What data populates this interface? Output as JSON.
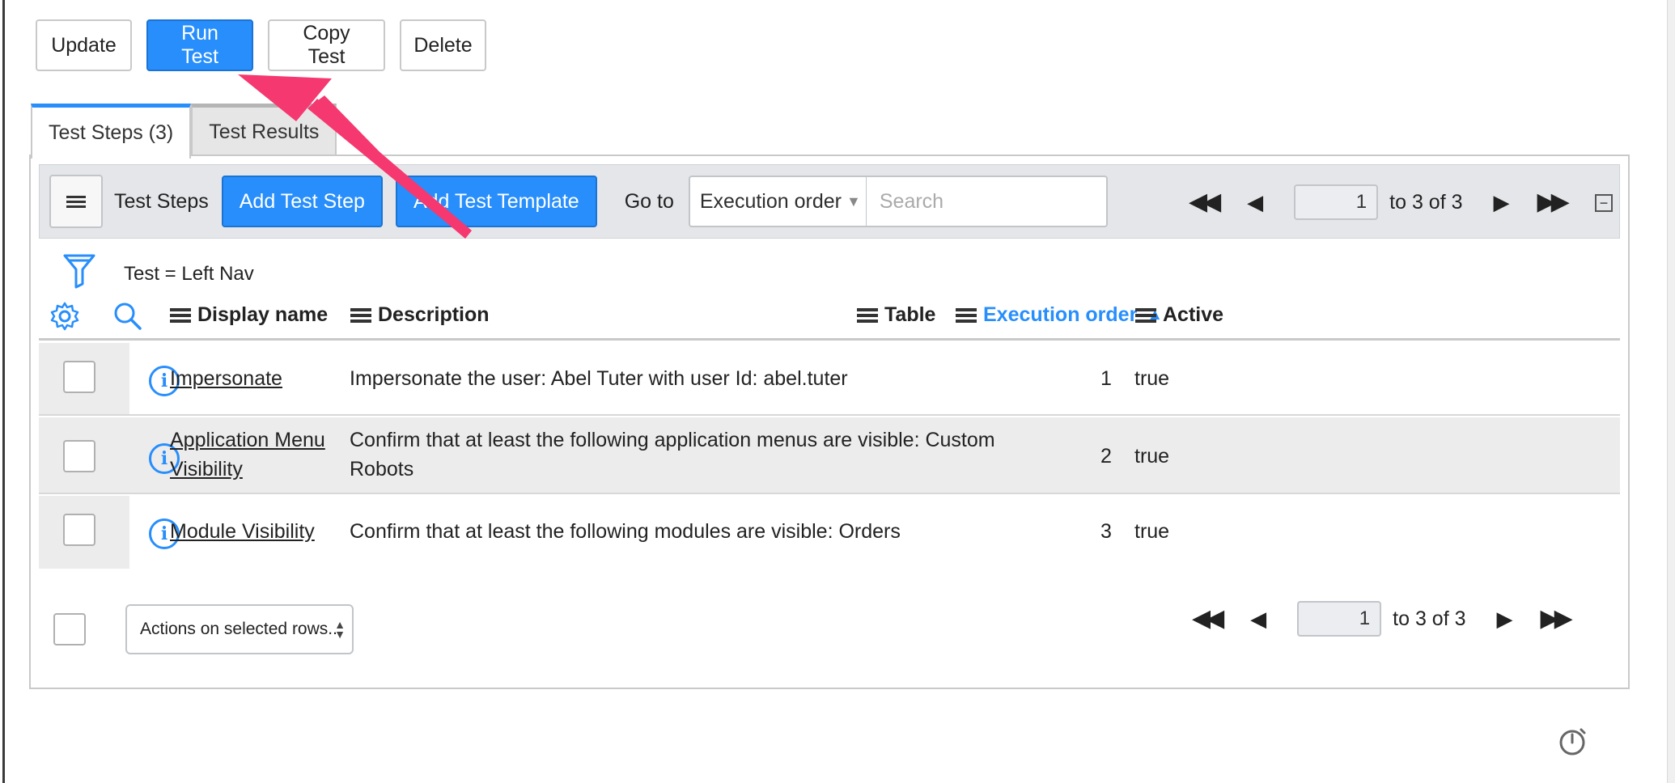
{
  "toolbar_top": {
    "update_label": "Update",
    "run_label": "Run Test",
    "copy_label": "Copy Test",
    "delete_label": "Delete"
  },
  "tabs": [
    {
      "label": "Test Steps (3)"
    },
    {
      "label": "Test Results"
    }
  ],
  "list_toolbar": {
    "title": "Test Steps",
    "add_step_label": "Add Test Step",
    "add_template_label": "Add Test Template",
    "goto_label": "Go to",
    "goto_field": "Execution order",
    "search_placeholder": "Search"
  },
  "pager": {
    "page": "1",
    "range": "to 3 of 3"
  },
  "filter": {
    "text": "Test = Left Nav"
  },
  "columns": {
    "display_name": "Display name",
    "description": "Description",
    "table": "Table",
    "execution_order": "Execution order",
    "active": "Active"
  },
  "rows": [
    {
      "name": "Impersonate",
      "description": "Impersonate the user: Abel Tuter with user Id: abel.tuter",
      "table": "",
      "order": "1",
      "active": "true"
    },
    {
      "name_line1": "Application Menu",
      "name_line2": "Visibility",
      "description_line1": "Confirm that at least the following application menus are visible: Custom",
      "description_line2": "Robots",
      "table": "",
      "order": "2",
      "active": "true"
    },
    {
      "name": "Module Visibility",
      "description": "Confirm that at least the following modules are visible: Orders",
      "table": "",
      "order": "3",
      "active": "true"
    }
  ],
  "footer": {
    "actions_label": "Actions on selected rows..."
  },
  "icons": {
    "menu": "hamburger-icon",
    "first": "first-page-icon",
    "prev": "prev-page-icon",
    "next": "next-page-icon",
    "last": "last-page-icon",
    "collapse": "collapse-icon",
    "filter": "filter-icon",
    "settings": "gear-icon",
    "search": "search-icon",
    "info": "info-icon",
    "timer": "stopwatch-icon"
  },
  "colors": {
    "accent": "#278efc",
    "annotation_arrow": "#f5386f"
  }
}
